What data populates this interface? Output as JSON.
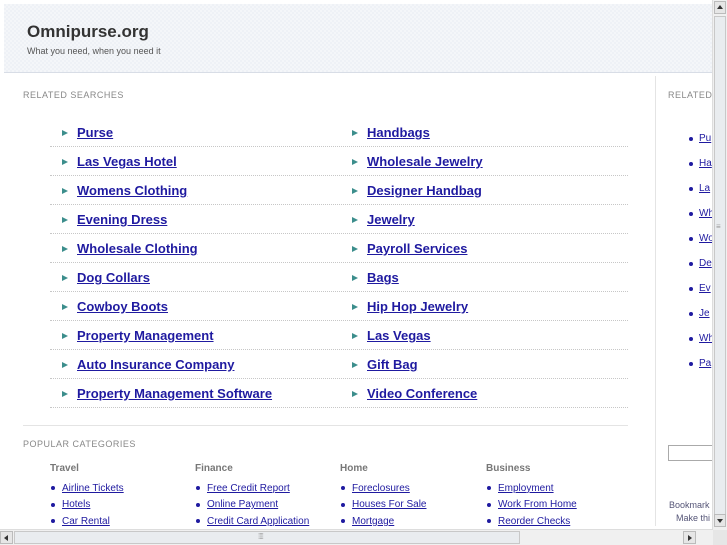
{
  "header": {
    "title": "Omnipurse.org",
    "tagline": "What you need, when you need it"
  },
  "related": {
    "title": "RELATED SEARCHES",
    "left": [
      "Purse",
      "Las Vegas Hotel",
      "Womens Clothing",
      "Evening Dress",
      "Wholesale Clothing",
      "Dog Collars",
      "Cowboy Boots",
      "Property Management",
      "Auto Insurance Company",
      "Property Management Software"
    ],
    "right": [
      "Handbags",
      "Wholesale Jewelry",
      "Designer Handbag",
      "Jewelry",
      "Payroll Services",
      "Bags",
      "Hip Hop Jewelry",
      "Las Vegas",
      "Gift Bag",
      "Video Conference"
    ]
  },
  "side_panel": {
    "title": "RELATED",
    "items": [
      "Pu",
      "Ha",
      "La",
      "Wh",
      "Wo",
      "De",
      "Ev",
      "Je",
      "Wh",
      "Pa"
    ],
    "bookmark": "Bookmark",
    "make": "Make thi"
  },
  "popular": {
    "title": "POPULAR CATEGORIES",
    "columns": [
      {
        "heading": "Travel",
        "items": [
          "Airline Tickets",
          "Hotels",
          "Car Rental"
        ]
      },
      {
        "heading": "Finance",
        "items": [
          "Free Credit Report",
          "Online Payment",
          "Credit Card Application"
        ]
      },
      {
        "heading": "Home",
        "items": [
          "Foreclosures",
          "Houses For Sale",
          "Mortgage"
        ]
      },
      {
        "heading": "Business",
        "items": [
          "Employment",
          "Work From Home",
          "Reorder Checks"
        ]
      }
    ]
  },
  "colors": {
    "link": "#1f1aa0",
    "arrow": "#3c8e8c",
    "header_bg": "#eef1f6"
  },
  "icons": {
    "result_marker": "arrow-right-icon",
    "list_marker": "bullet-icon"
  }
}
